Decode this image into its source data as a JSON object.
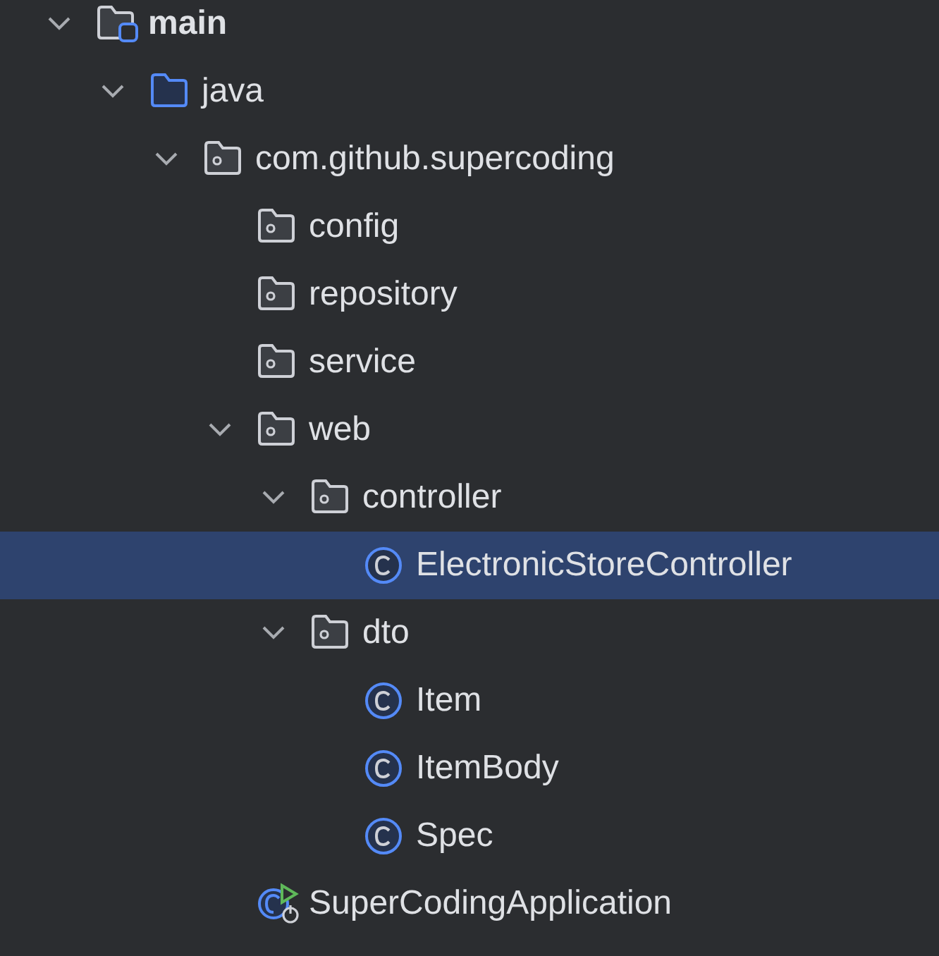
{
  "tree": [
    {
      "label": "main",
      "kind": "source-root",
      "expanded": true,
      "selected": false,
      "children": [
        {
          "label": "java",
          "kind": "folder",
          "expanded": true,
          "selected": false,
          "children": [
            {
              "label": "com.github.supercoding",
              "kind": "package",
              "expanded": true,
              "selected": false,
              "children": [
                {
                  "label": "config",
                  "kind": "package",
                  "selected": false
                },
                {
                  "label": "repository",
                  "kind": "package",
                  "selected": false
                },
                {
                  "label": "service",
                  "kind": "package",
                  "selected": false
                },
                {
                  "label": "web",
                  "kind": "package",
                  "expanded": true,
                  "selected": false,
                  "children": [
                    {
                      "label": "controller",
                      "kind": "package",
                      "expanded": true,
                      "selected": false,
                      "children": [
                        {
                          "label": "ElectronicStoreController",
                          "kind": "class",
                          "selected": true
                        }
                      ]
                    },
                    {
                      "label": "dto",
                      "kind": "package",
                      "expanded": true,
                      "selected": false,
                      "children": [
                        {
                          "label": "Item",
                          "kind": "class",
                          "selected": false
                        },
                        {
                          "label": "ItemBody",
                          "kind": "class",
                          "selected": false
                        },
                        {
                          "label": "Spec",
                          "kind": "class",
                          "selected": false
                        }
                      ]
                    }
                  ]
                },
                {
                  "label": "SuperCodingApplication",
                  "kind": "app",
                  "selected": false
                }
              ]
            }
          ]
        }
      ]
    }
  ]
}
